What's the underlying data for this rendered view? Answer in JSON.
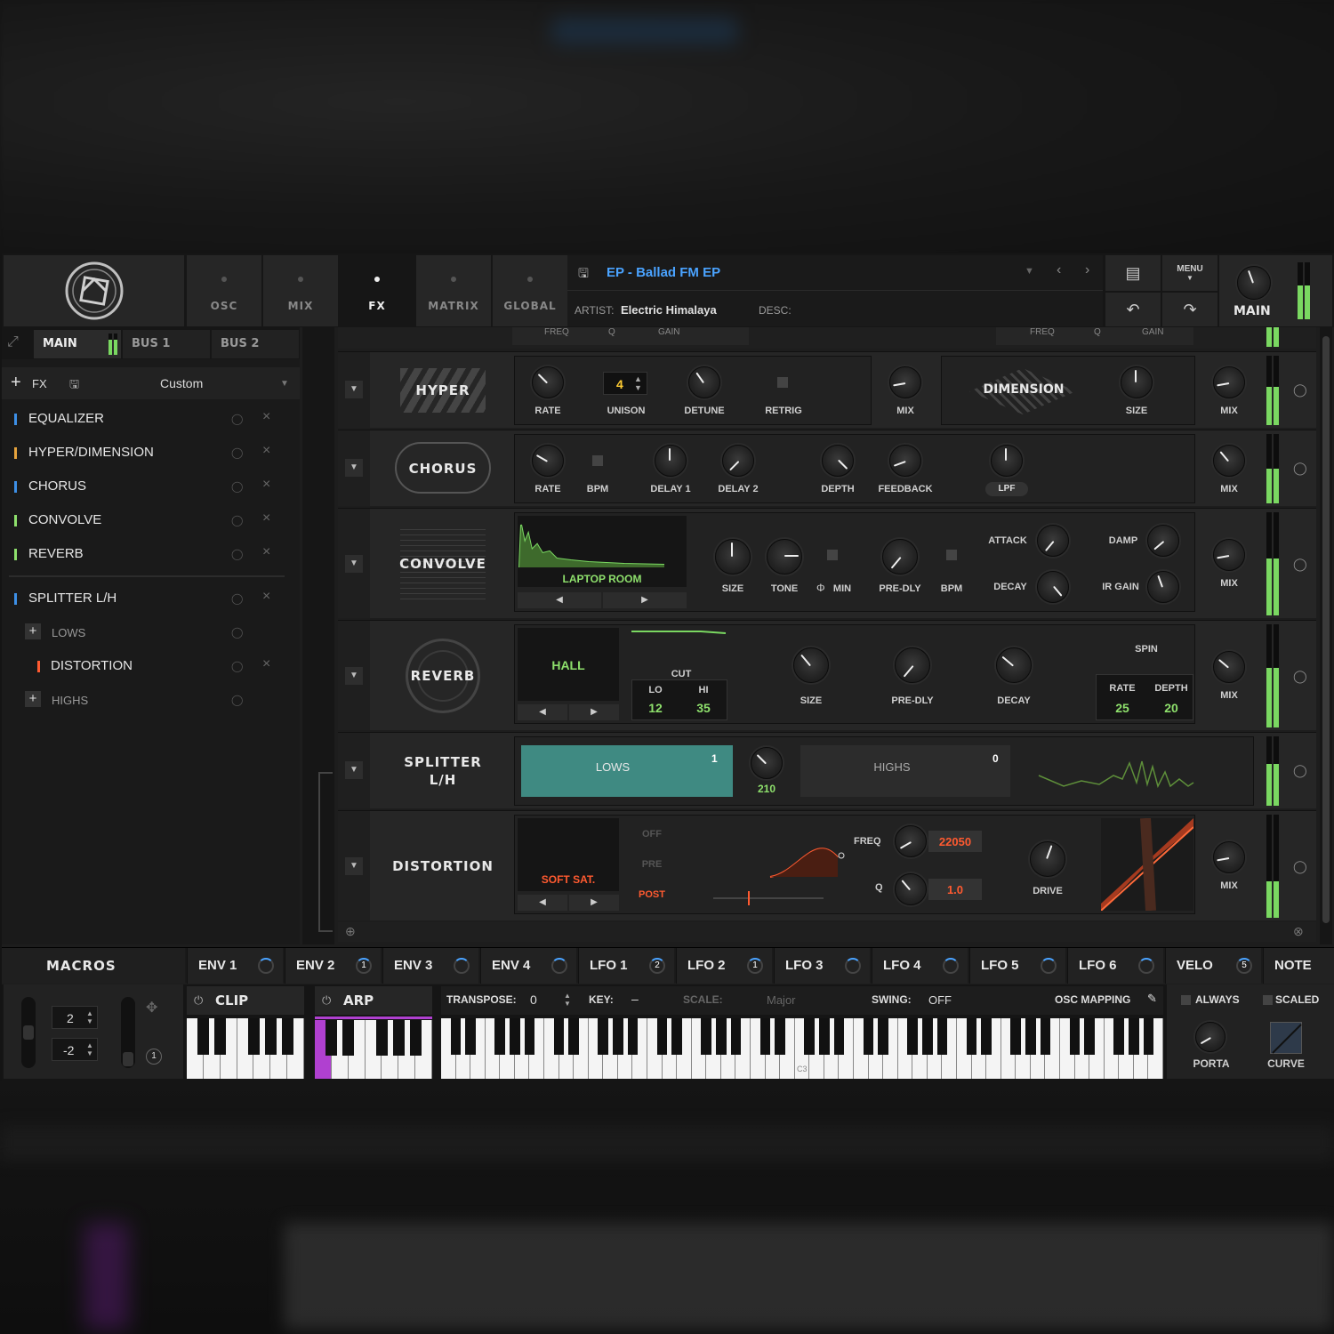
{
  "header": {
    "tabs": [
      {
        "label": "OSC"
      },
      {
        "label": "MIX"
      },
      {
        "label": "FX"
      },
      {
        "label": "MATRIX"
      },
      {
        "label": "GLOBAL"
      }
    ],
    "preset_name": "EP - Ballad FM EP",
    "artist_label": "ARTIST:",
    "artist_value": "Electric Himalaya",
    "desc_label": "DESC:",
    "menu_label": "MENU",
    "main_label": "MAIN"
  },
  "left_panel": {
    "bus_tabs": [
      "MAIN",
      "BUS 1",
      "BUS 2"
    ],
    "add_fx_label": "FX",
    "fx_preset": "Custom",
    "fx_list": [
      {
        "name": "EQUALIZER",
        "color": "#3d8fe6"
      },
      {
        "name": "HYPER/DIMENSION",
        "color": "#e6a33d"
      },
      {
        "name": "CHORUS",
        "color": "#3d8fe6"
      },
      {
        "name": "CONVOLVE",
        "color": "#8ee06c"
      },
      {
        "name": "REVERB",
        "color": "#8ee06c"
      }
    ],
    "splitter": {
      "name": "SPLITTER L/H",
      "lows": "LOWS",
      "child": "DISTORTION",
      "highs": "HIGHS"
    }
  },
  "eq_strip": {
    "left": [
      "FREQ",
      "Q",
      "GAIN"
    ],
    "right": [
      "FREQ",
      "Q",
      "GAIN"
    ]
  },
  "hyper": {
    "title": "HYPER",
    "labels": [
      "RATE",
      "UNISON",
      "DETUNE",
      "RETRIG",
      "MIX"
    ],
    "unison_value": "4",
    "dimension_title": "DIMENSION",
    "dimension_labels": [
      "SIZE",
      "MIX"
    ]
  },
  "chorus": {
    "title": "CHORUS",
    "labels": [
      "RATE",
      "BPM",
      "DELAY 1",
      "DELAY 2",
      "DEPTH",
      "FEEDBACK",
      "LPF",
      "MIX"
    ]
  },
  "convolve": {
    "title": "CONVOLVE",
    "ir_name": "LAPTOP ROOM",
    "labels": [
      "SIZE",
      "TONE",
      "MIN",
      "PRE-DLY",
      "BPM",
      "ATTACK",
      "DECAY",
      "DAMP",
      "IR GAIN",
      "MIX"
    ]
  },
  "reverb": {
    "title": "REVERB",
    "type": "HALL",
    "cut_label": "CUT",
    "lo_label": "LO",
    "hi_label": "HI",
    "lo_value": "12",
    "hi_value": "35",
    "labels": [
      "SIZE",
      "PRE-DLY",
      "DECAY",
      "MIX"
    ],
    "spin_label": "SPIN",
    "spin_rate_label": "RATE",
    "spin_depth_label": "DEPTH",
    "spin_rate": "25",
    "spin_depth": "20"
  },
  "splitter": {
    "title_1": "SPLITTER",
    "title_2": "L/H",
    "lows": "LOWS",
    "lows_count": "1",
    "freq": "210",
    "highs": "HIGHS",
    "highs_count": "0"
  },
  "distortion": {
    "title": "DISTORTION",
    "type": "SOFT SAT.",
    "routing": [
      "OFF",
      "PRE",
      "POST"
    ],
    "freq_label": "FREQ",
    "freq_value": "22050",
    "q_label": "Q",
    "q_value": "1.0",
    "drive_label": "DRIVE",
    "mix_label": "MIX"
  },
  "macros": {
    "title": "MACROS",
    "items": [
      {
        "label": "ENV 1",
        "badge": ""
      },
      {
        "label": "ENV 2",
        "badge": "1"
      },
      {
        "label": "ENV 3",
        "badge": ""
      },
      {
        "label": "ENV 4",
        "badge": ""
      },
      {
        "label": "LFO 1",
        "badge": "2"
      },
      {
        "label": "LFO 2",
        "badge": "1"
      },
      {
        "label": "LFO 3",
        "badge": ""
      },
      {
        "label": "LFO 4",
        "badge": ""
      },
      {
        "label": "LFO 5",
        "badge": ""
      },
      {
        "label": "LFO 6",
        "badge": ""
      },
      {
        "label": "VELO",
        "badge": "5"
      },
      {
        "label": "NOTE",
        "badge": "2"
      }
    ]
  },
  "bottom": {
    "pitch_up": "2",
    "pitch_down": "-2",
    "mod_badge": "1",
    "clip_label": "CLIP",
    "arp_label": "ARP",
    "transpose_label": "TRANSPOSE:",
    "transpose_value": "0",
    "key_label": "KEY:",
    "key_value": "–",
    "scale_label": "SCALE:",
    "scale_value": "Major",
    "swing_label": "SWING:",
    "swing_value": "OFF",
    "osc_mapping": "OSC MAPPING",
    "c3_label": "C3",
    "always_label": "ALWAYS",
    "scaled_label": "SCALED",
    "porta_label": "PORTA",
    "curve_label": "CURVE"
  }
}
